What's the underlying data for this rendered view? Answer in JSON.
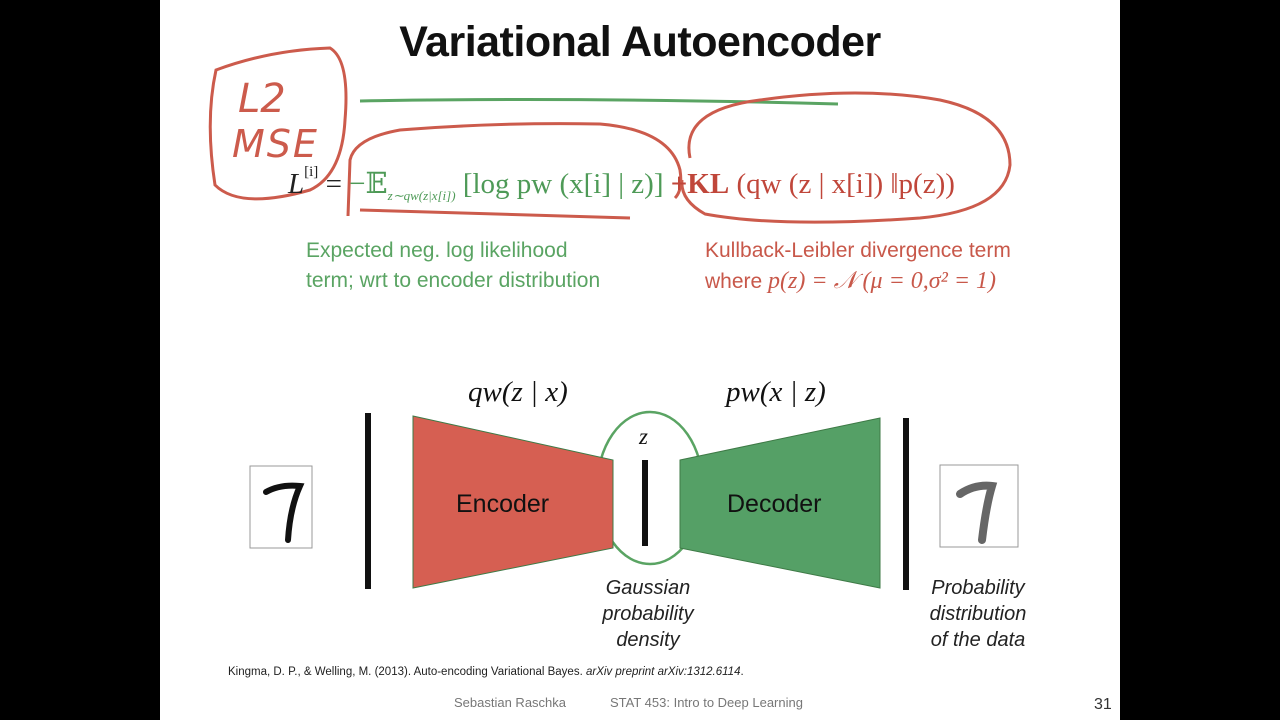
{
  "slide": {
    "title": "Variational Autoencoder",
    "annotations": {
      "handwritten_line1": "L2",
      "handwritten_line2": "MSE"
    },
    "equation": {
      "lhs": "L",
      "lhs_superscript": "[i]",
      "equals": "=",
      "reconstruction_term": "−𝔼",
      "reconstruction_subscript": "z∼qw(z|x[i])",
      "log_term": "[log pw (x[i] | z)]",
      "plus": "+",
      "kl": "KL",
      "kl_args": "(qw (z | x[i]) ‖p(z))"
    },
    "notes": {
      "left_line1": "Expected neg. log likelihood",
      "left_line2": "term; wrt to encoder distribution",
      "right_line1": "Kullback-Leibler divergence term",
      "right_line2_prefix": "where",
      "right_line2_math": "p(z) = 𝒩 (μ = 0,σ² = 1)"
    },
    "diagram": {
      "encoder_label": "Encoder",
      "decoder_label": "Decoder",
      "encoder_dist": "qw(z | x)",
      "decoder_dist": "pw(x | z)",
      "latent_label": "z",
      "latent_caption": [
        "Gaussian",
        "probability",
        "density"
      ],
      "output_caption": [
        "Probability",
        "distribution",
        "of the data"
      ],
      "input_digit": "7",
      "output_digit": "7",
      "colors": {
        "encoder": "#d65f52",
        "decoder": "#55a066",
        "annotation_red": "#cc5b4c",
        "annotation_green": "#5aa463"
      }
    },
    "reference": {
      "authors": "Kingma, D. P., & Welling, M. (2013). Auto-encoding Variational Bayes.",
      "journal": "arXiv preprint arXiv:1312.6114",
      "end": "."
    },
    "footer": {
      "author": "Sebastian Raschka",
      "course": "STAT 453: Intro to Deep Learning",
      "page_number": "31"
    }
  }
}
